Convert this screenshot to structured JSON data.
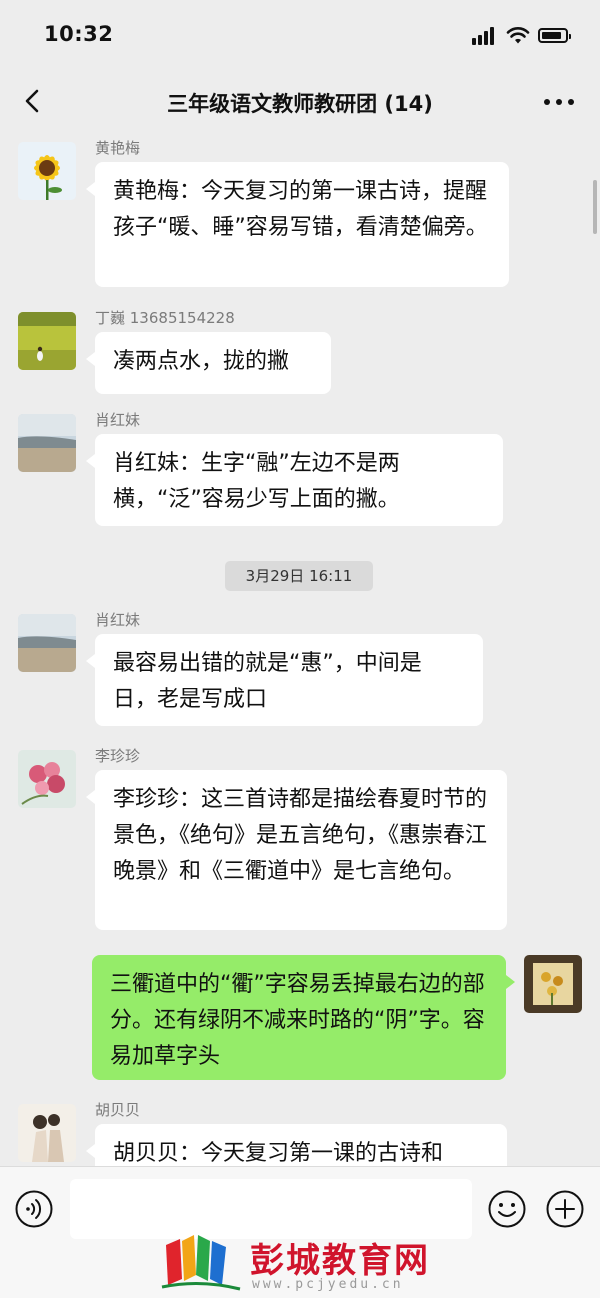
{
  "status_bar": {
    "time": "10:32"
  },
  "header": {
    "title": "三年级语文教师教研团 (14)"
  },
  "messages": [
    {
      "sender": "黄艳梅",
      "text": "黄艳梅：今天复习的第一课古诗，提醒孩子“暖、睡”容易写错，看清楚偏旁。"
    },
    {
      "sender": "丁巍  13685154228",
      "text": "凑两点水，拢的撇"
    },
    {
      "sender": "肖红妹",
      "text": "肖红妹：生字“融”左边不是两横，“泛”容易少写上面的撇。"
    },
    {
      "sender": "肖红妹",
      "text": "最容易出错的就是“惠”，中间是日，老是写成口"
    },
    {
      "sender": "李珍珍",
      "text": "李珍珍：这三首诗都是描绘春夏时节的景色，《绝句》是五言绝句，《惠崇春江晚景》和《三衢道中》是七言绝句。"
    },
    {
      "sender": "",
      "text": "三衢道中的“衢”字容易丢掉最右边的部分。还有绿阴不减来时路的“阴”字。容易加草字头"
    },
    {
      "sender": "胡贝贝",
      "text": "胡贝贝：今天复习第一课的古诗和"
    }
  ],
  "timestamp": "3月29日 16:11",
  "watermark": {
    "name": "彭城教育网",
    "url": "www.pcjyedu.cn"
  },
  "colors": {
    "background": "#ededed",
    "bubble_in": "#ffffff",
    "bubble_out": "#95ec69",
    "watermark": "#d0142c"
  }
}
